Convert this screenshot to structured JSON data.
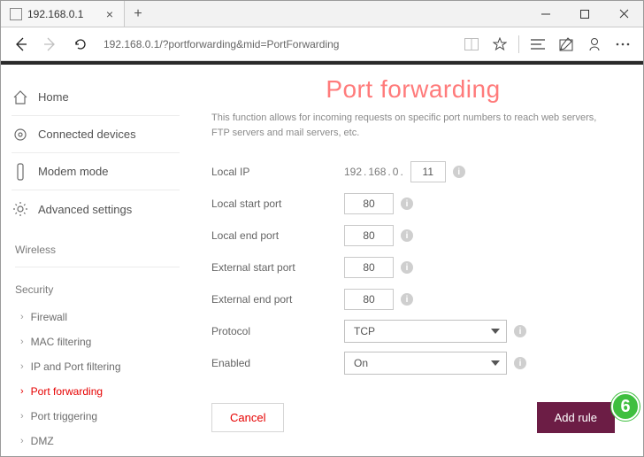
{
  "browser": {
    "tab_title": "192.168.0.1",
    "url": "192.168.0.1/?portforwarding&mid=PortForwarding"
  },
  "sidebar": {
    "items": [
      {
        "label": "Home"
      },
      {
        "label": "Connected devices"
      },
      {
        "label": "Modem mode"
      },
      {
        "label": "Advanced settings"
      }
    ],
    "section_wireless": "Wireless",
    "section_security": "Security",
    "security_items": [
      {
        "label": "Firewall"
      },
      {
        "label": "MAC filtering"
      },
      {
        "label": "IP and Port filtering"
      },
      {
        "label": "Port forwarding",
        "active": true
      },
      {
        "label": "Port triggering"
      },
      {
        "label": "DMZ"
      }
    ]
  },
  "main": {
    "title": "Port forwarding",
    "description": "This function allows for incoming requests on specific port numbers to reach web servers, FTP servers and mail servers, etc.",
    "fields": {
      "local_ip_label": "Local IP",
      "local_ip_prefix_a": "192",
      "local_ip_prefix_b": "168",
      "local_ip_prefix_c": "0",
      "local_ip_host": "11",
      "local_start_port_label": "Local start port",
      "local_start_port": "80",
      "local_end_port_label": "Local end port",
      "local_end_port": "80",
      "external_start_port_label": "External start port",
      "external_start_port": "80",
      "external_end_port_label": "External end port",
      "external_end_port": "80",
      "protocol_label": "Protocol",
      "protocol_value": "TCP",
      "enabled_label": "Enabled",
      "enabled_value": "On"
    },
    "buttons": {
      "cancel": "Cancel",
      "add_rule": "Add rule"
    }
  },
  "callout": "6"
}
